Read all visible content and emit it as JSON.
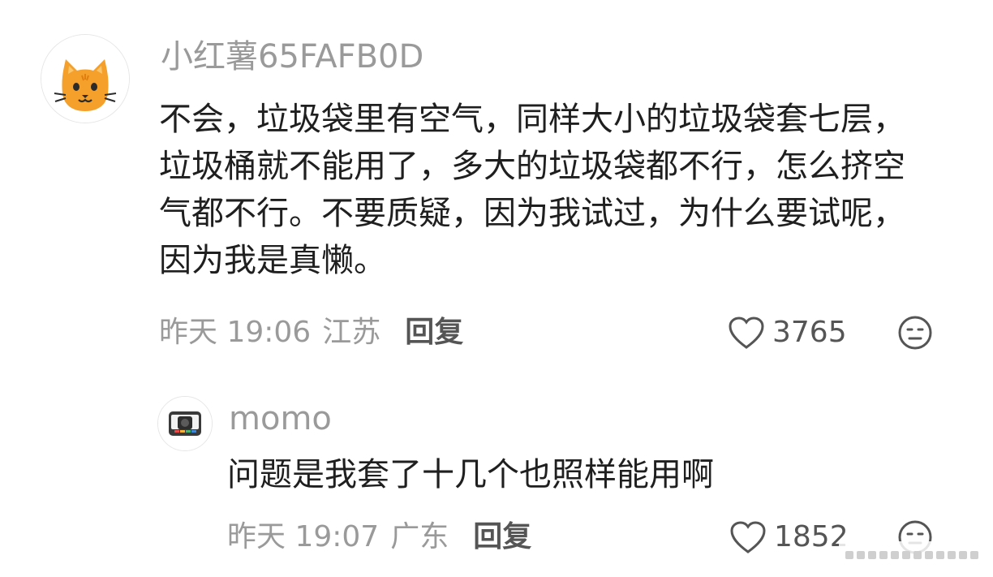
{
  "comments": [
    {
      "username": "小红薯65FAFB0D",
      "avatar_icon": "cat-face-avatar",
      "text": "不会，垃圾袋里有空气，同样大小的垃圾袋套七层，垃圾桶就不能用了，多大的垃圾袋都不行，怎么挤空气都不行。不要质疑，因为我试过，为什么要试呢，因为我是真懒。",
      "time": "昨天 19:06",
      "location": "江苏",
      "reply_label": "回复",
      "like_count": "3765",
      "like_icon": "heart-outline-icon",
      "reaction_icon": "neutral-face-icon"
    },
    {
      "username": "momo",
      "avatar_icon": "camera-avatar",
      "text": "问题是我套了十几个也照样能用啊",
      "time": "昨天 19:07",
      "location": "广东",
      "reply_label": "回复",
      "like_count": "1852",
      "like_icon": "heart-outline-icon",
      "reaction_icon": "neutral-face-icon"
    }
  ]
}
